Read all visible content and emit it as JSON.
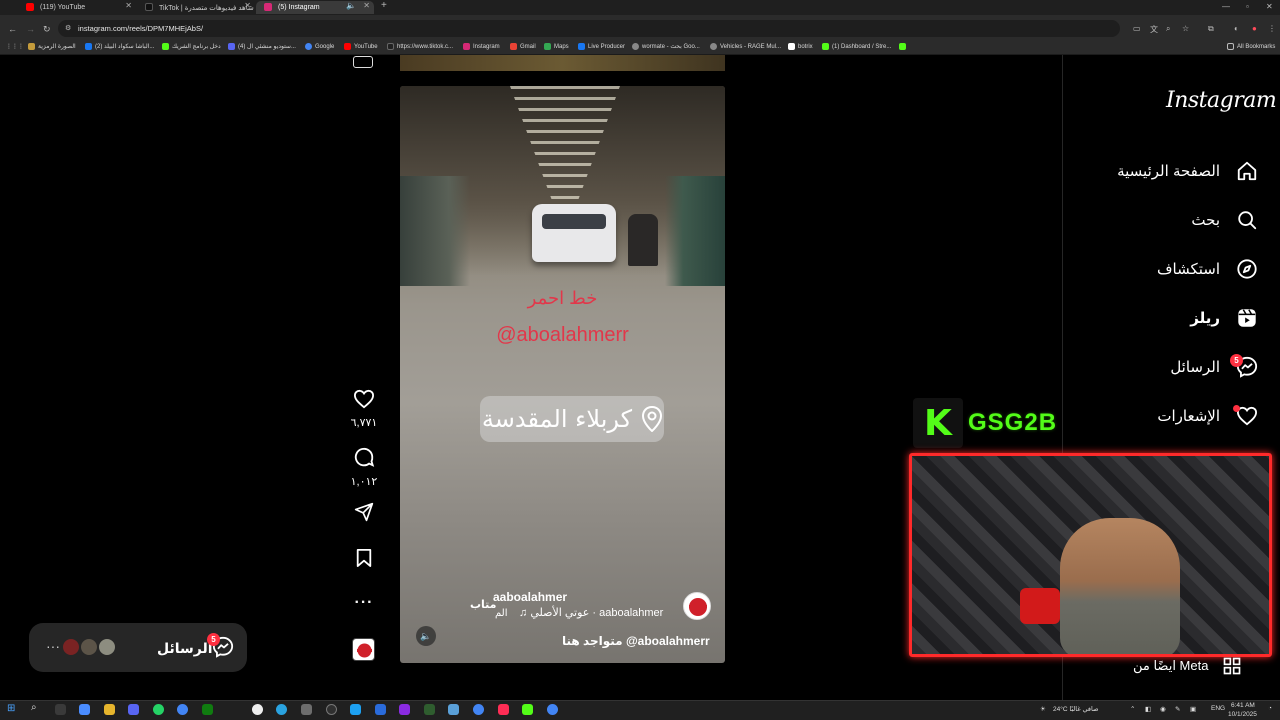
{
  "browser": {
    "tabs": [
      {
        "label": "(119) YouTube",
        "color": "#ff0000"
      },
      {
        "label": "TikTok | شاهد فيديوهات متصدرة",
        "color": "#111111"
      },
      {
        "label": "(5) Instagram",
        "color": "#d62976"
      }
    ],
    "new_tab": "+",
    "url": "instagram.com/reels/DPM7MHEjAbS/",
    "bookmarks": [
      {
        "label": "الصورة الرمزية",
        "color": "#c49b3b"
      },
      {
        "label": "(2) الباشا سكواد البيلد...",
        "color": "#1877f2"
      },
      {
        "label": "دخل برنامج الشريك",
        "color": "#53fc18"
      },
      {
        "label": "(4) ستوديو منشئي ال...",
        "color": "#5865f2"
      },
      {
        "label": "Google",
        "color": "#4285f4"
      },
      {
        "label": "YouTube",
        "color": "#ff0000"
      },
      {
        "label": "https://www.tiktok.c...",
        "color": "#222222"
      },
      {
        "label": "Instagram",
        "color": "#d62976"
      },
      {
        "label": "Gmail",
        "color": "#ea4335"
      },
      {
        "label": "Maps",
        "color": "#34a853"
      },
      {
        "label": "Live Producer",
        "color": "#1877f2"
      },
      {
        "label": "wormate - بحث Goo...",
        "color": "#888888"
      },
      {
        "label": "Vehicles - RAGE Mul...",
        "color": "#888888"
      },
      {
        "label": "botrix",
        "color": "#ffffff"
      },
      {
        "label": "(1) Dashboard / Stre...",
        "color": "#53fc18"
      }
    ],
    "all_bookmarks": "All Bookmarks"
  },
  "reel": {
    "overlay_name": "خط احمر",
    "overlay_handle": "@aboalahmerr",
    "location": "كربلاء المقدسة",
    "author": "aaboalahmer",
    "follow_label": "متاب",
    "audio": "♫ عوتي الأصلي · aaboalahmer",
    "audio_suffix": "الم",
    "caption": "متواجد هنا @aboalahmerr",
    "mute_icon": "🔈"
  },
  "actions": {
    "likes": "٦,٧٧١",
    "comments": "١,٠١٢"
  },
  "messages": {
    "label": "الرسائل",
    "badge": "5",
    "more": "···"
  },
  "sidebar": {
    "logo": "Instagram",
    "items": [
      {
        "label": "الصفحة الرئيسية",
        "icon": "home-icon"
      },
      {
        "label": "بحث",
        "icon": "search-icon"
      },
      {
        "label": "استكشاف",
        "icon": "compass-icon"
      },
      {
        "label": "ريلز",
        "icon": "reels-icon"
      },
      {
        "label": "الرسائل",
        "icon": "messenger-icon",
        "badge": "5"
      },
      {
        "label": "الإشعارات",
        "icon": "heart-icon"
      }
    ],
    "meta": "ايضًا من Meta"
  },
  "stream_overlay": {
    "kick_letter": "K",
    "channel": "GSG2B",
    "accent": "#53fc18",
    "frame": "#ff2a2a"
  },
  "taskbar": {
    "weather": "24°C صافي غالبًا",
    "lang": "ENG",
    "time": "6:41 AM",
    "date": "10/1/2025"
  }
}
